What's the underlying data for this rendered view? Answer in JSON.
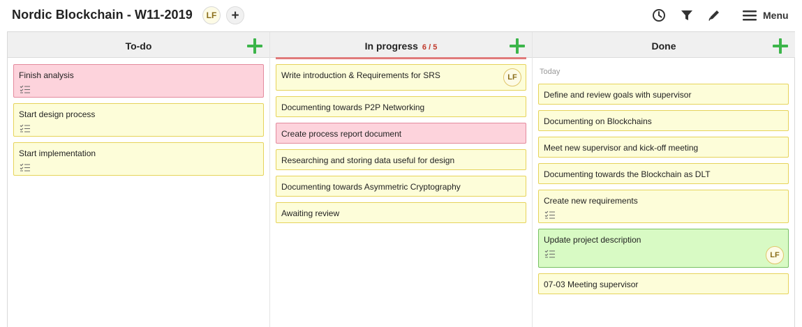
{
  "header": {
    "title": "Nordic Blockchain - W11-2019",
    "member_initials": "LF",
    "add_member_label": "+",
    "icons": [
      "clock-icon",
      "filter-icon",
      "pencil-icon",
      "hamburger-icon"
    ],
    "menu_label": "Menu"
  },
  "colors": {
    "card_yellow": "#fdfdd9",
    "card_pink": "#fdd3dc",
    "card_green": "#d8fac4",
    "add_green": "#3cb54a",
    "wip_red": "#c0392b"
  },
  "columns": [
    {
      "title": "To-do",
      "cards": [
        {
          "text": "Finish analysis",
          "color": "pink",
          "checklist": true
        },
        {
          "text": "Start design process",
          "color": "yellow",
          "checklist": true
        },
        {
          "text": "Start implementation",
          "color": "yellow",
          "checklist": true
        }
      ]
    },
    {
      "title": "In progress",
      "wip": "6 / 5",
      "cards": [
        {
          "text": "Write introduction & Requirements for SRS",
          "color": "yellow",
          "avatar": "LF"
        },
        {
          "text": "Documenting towards P2P Networking",
          "color": "yellow"
        },
        {
          "text": "Create process report document",
          "color": "pink"
        },
        {
          "text": "Researching and storing data useful for design",
          "color": "yellow"
        },
        {
          "text": "Documenting towards Asymmetric Cryptography",
          "color": "yellow"
        },
        {
          "text": "Awaiting review",
          "color": "yellow"
        }
      ]
    },
    {
      "title": "Done",
      "group_label": "Today",
      "cards": [
        {
          "text": "Define and review goals with supervisor",
          "color": "yellow"
        },
        {
          "text": "Documenting on Blockchains",
          "color": "yellow"
        },
        {
          "text": "Meet new supervisor and kick-off meeting",
          "color": "yellow"
        },
        {
          "text": "Documenting towards the Blockchain as DLT",
          "color": "yellow"
        },
        {
          "text": "Create new requirements",
          "color": "yellow",
          "checklist": true
        },
        {
          "text": "Update project description",
          "color": "green",
          "checklist": true,
          "avatar": "LF"
        },
        {
          "text": "07-03 Meeting supervisor",
          "color": "yellow"
        }
      ]
    }
  ]
}
